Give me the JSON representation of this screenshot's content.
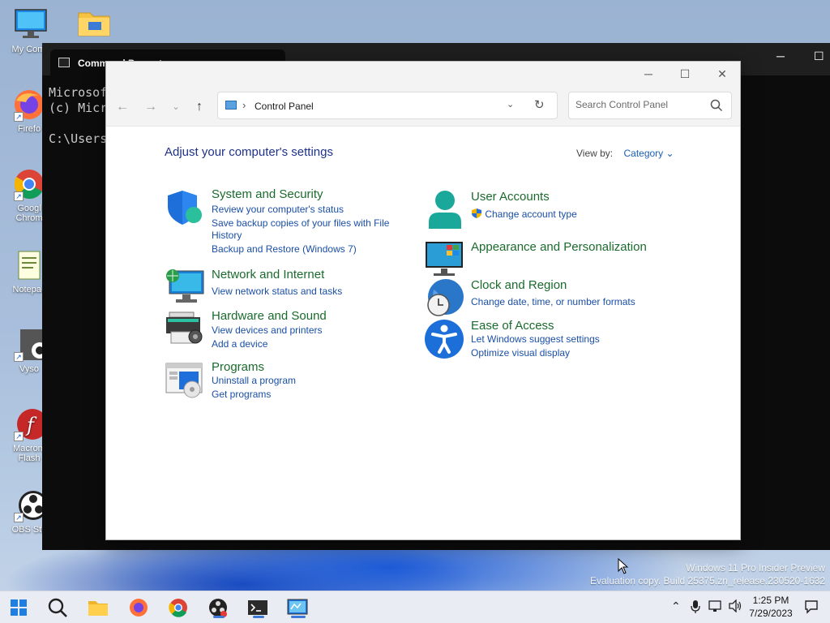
{
  "desktop": {
    "icons": [
      {
        "label": "My Comp"
      },
      {
        "label": ""
      },
      {
        "label": "Firefo"
      },
      {
        "label": "Googl Chrom"
      },
      {
        "label": "Notepac"
      },
      {
        "label": "Vyso"
      },
      {
        "label": "Macrom Flash"
      },
      {
        "label": "OBS Stu"
      }
    ]
  },
  "terminal": {
    "tab_title": "Command Prompt",
    "lines": [
      "Microsof",
      "(c) Micr",
      "",
      "C:\\Users"
    ]
  },
  "control_panel": {
    "address_path": "Control Panel",
    "search_placeholder": "Search Control Panel",
    "heading": "Adjust your computer's settings",
    "view_by_label": "View by:",
    "view_by_value": "Category",
    "left_categories": [
      {
        "title": "System and Security",
        "links": [
          "Review your computer's status",
          "Save backup copies of your files with File",
          "History",
          "Backup and Restore (Windows 7)"
        ],
        "icon": "shield-icon"
      },
      {
        "title": "Network and Internet",
        "links": [
          "View network status and tasks"
        ],
        "icon": "network-globe-icon"
      },
      {
        "title": "Hardware and Sound",
        "links": [
          "View devices and printers",
          "Add a device"
        ],
        "icon": "printer-icon"
      },
      {
        "title": "Programs",
        "links": [
          "Uninstall a program",
          "Get programs"
        ],
        "icon": "programs-icon"
      }
    ],
    "right_categories": [
      {
        "title": "User Accounts",
        "links": [
          "Change account type"
        ],
        "icon": "user-icon"
      },
      {
        "title": "Appearance and Personalization",
        "links": [],
        "icon": "monitor-icon"
      },
      {
        "title": "Clock and Region",
        "links": [
          "Change date, time, or number formats"
        ],
        "icon": "clock-globe-icon"
      },
      {
        "title": "Ease of Access",
        "links": [
          "Let Windows suggest settings",
          "Optimize visual display"
        ],
        "icon": "accessibility-icon"
      }
    ]
  },
  "watermark": {
    "line1": "Windows 11 Pro Insider Preview",
    "line2": "Evaluation copy. Build 25375.zn_release.230520-1632"
  },
  "taskbar": {
    "time": "1:25 PM",
    "date": "7/29/2023"
  },
  "colors": {
    "category_title": "#1a6b2d",
    "link": "#1a4fa6",
    "heading": "#1e3287",
    "taskbar_accent": "#3c78d8"
  }
}
